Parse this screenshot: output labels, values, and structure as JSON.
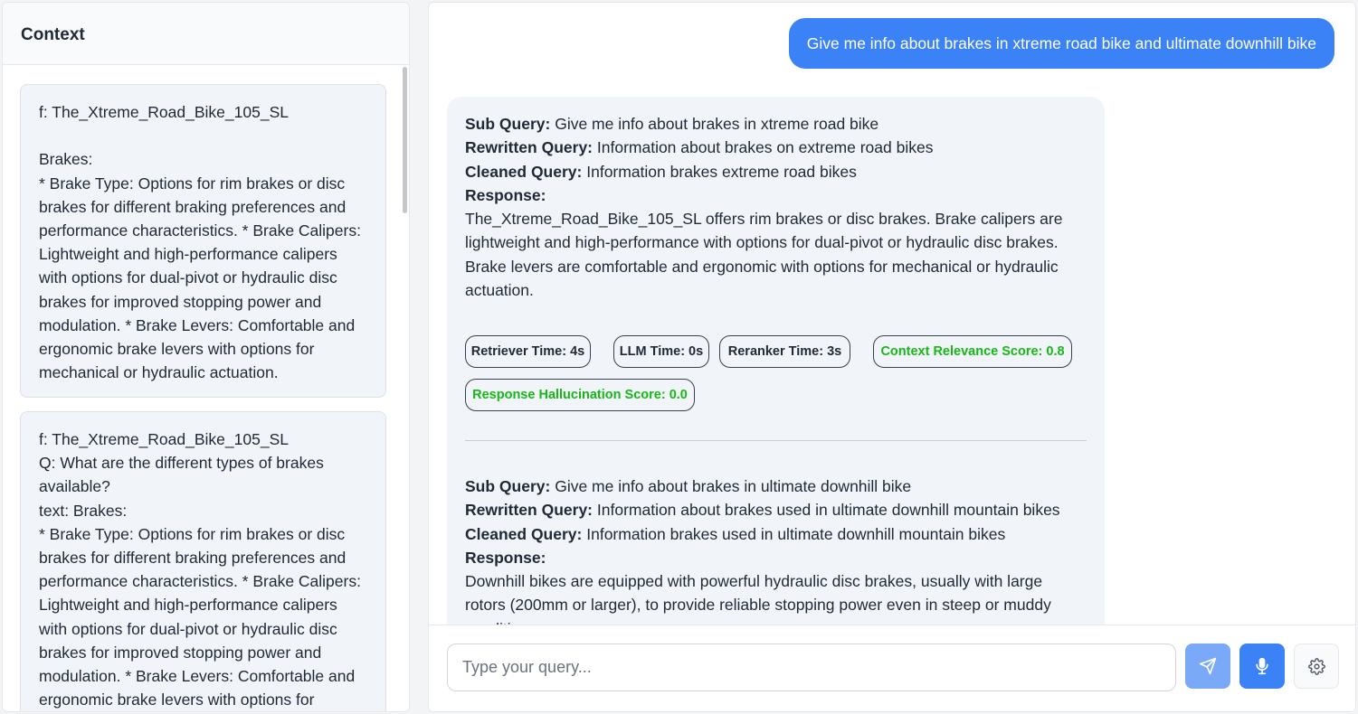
{
  "context": {
    "title": "Context",
    "cards": [
      {
        "text": "f: The_Xtreme_Road_Bike_105_SL\n\nBrakes:\n* Brake Type: Options for rim brakes or disc brakes for different braking preferences and performance characteristics. * Brake Calipers: Lightweight and high-performance calipers with options for dual-pivot or hydraulic disc brakes for improved stopping power and modulation. * Brake Levers: Comfortable and ergonomic brake levers with options for mechanical or hydraulic actuation."
      },
      {
        "text": "f: The_Xtreme_Road_Bike_105_SL\nQ: What are the different types of brakes available?\ntext: Brakes:\n* Brake Type: Options for rim brakes or disc brakes for different braking preferences and performance characteristics. * Brake Calipers: Lightweight and high-performance calipers with options for dual-pivot or hydraulic disc brakes for improved stopping power and modulation. * Brake Levers: Comfortable and ergonomic brake levers with options for"
      }
    ]
  },
  "chat": {
    "user_message": "Give me info about brakes in xtreme road bike and ultimate downhill bike",
    "labels": {
      "sub_query": "Sub Query:",
      "rewritten_query": "Rewritten Query:",
      "cleaned_query": "Cleaned Query:",
      "response": "Response:"
    },
    "answers": [
      {
        "sub_query": "Give me info about brakes in xtreme road bike",
        "rewritten_query": "Information about brakes on extreme road bikes",
        "cleaned_query": "Information brakes extreme road bikes",
        "response": "The_Xtreme_Road_Bike_105_SL offers rim brakes or disc brakes.  Brake calipers are lightweight and high-performance with options for dual-pivot or hydraulic disc brakes. Brake levers are comfortable and ergonomic with options for mechanical or hydraulic actuation.",
        "metrics": {
          "retriever_time": "Retriever Time: 4s",
          "llm_time": "LLM Time: 0s",
          "reranker_time": "Reranker Time: 3s",
          "context_relevance": "Context Relevance Score: 0.8",
          "response_hallucination": "Response Hallucination Score: 0.0"
        }
      },
      {
        "sub_query": "Give me info about brakes in ultimate downhill bike",
        "rewritten_query": "Information about brakes used in ultimate downhill mountain bikes",
        "cleaned_query": "Information brakes used in ultimate downhill mountain bikes",
        "response": "Downhill bikes are equipped with powerful hydraulic disc brakes, usually with large rotors (200mm or larger), to provide reliable stopping power even in steep or muddy conditions."
      }
    ]
  },
  "composer": {
    "placeholder": "Type your query..."
  },
  "icons": {
    "send": "send-icon",
    "mic": "microphone-icon",
    "settings": "gear-icon"
  },
  "colors": {
    "accent": "#3b82f6",
    "send_button": "#7aa9f7",
    "score_green": "#16b816"
  }
}
